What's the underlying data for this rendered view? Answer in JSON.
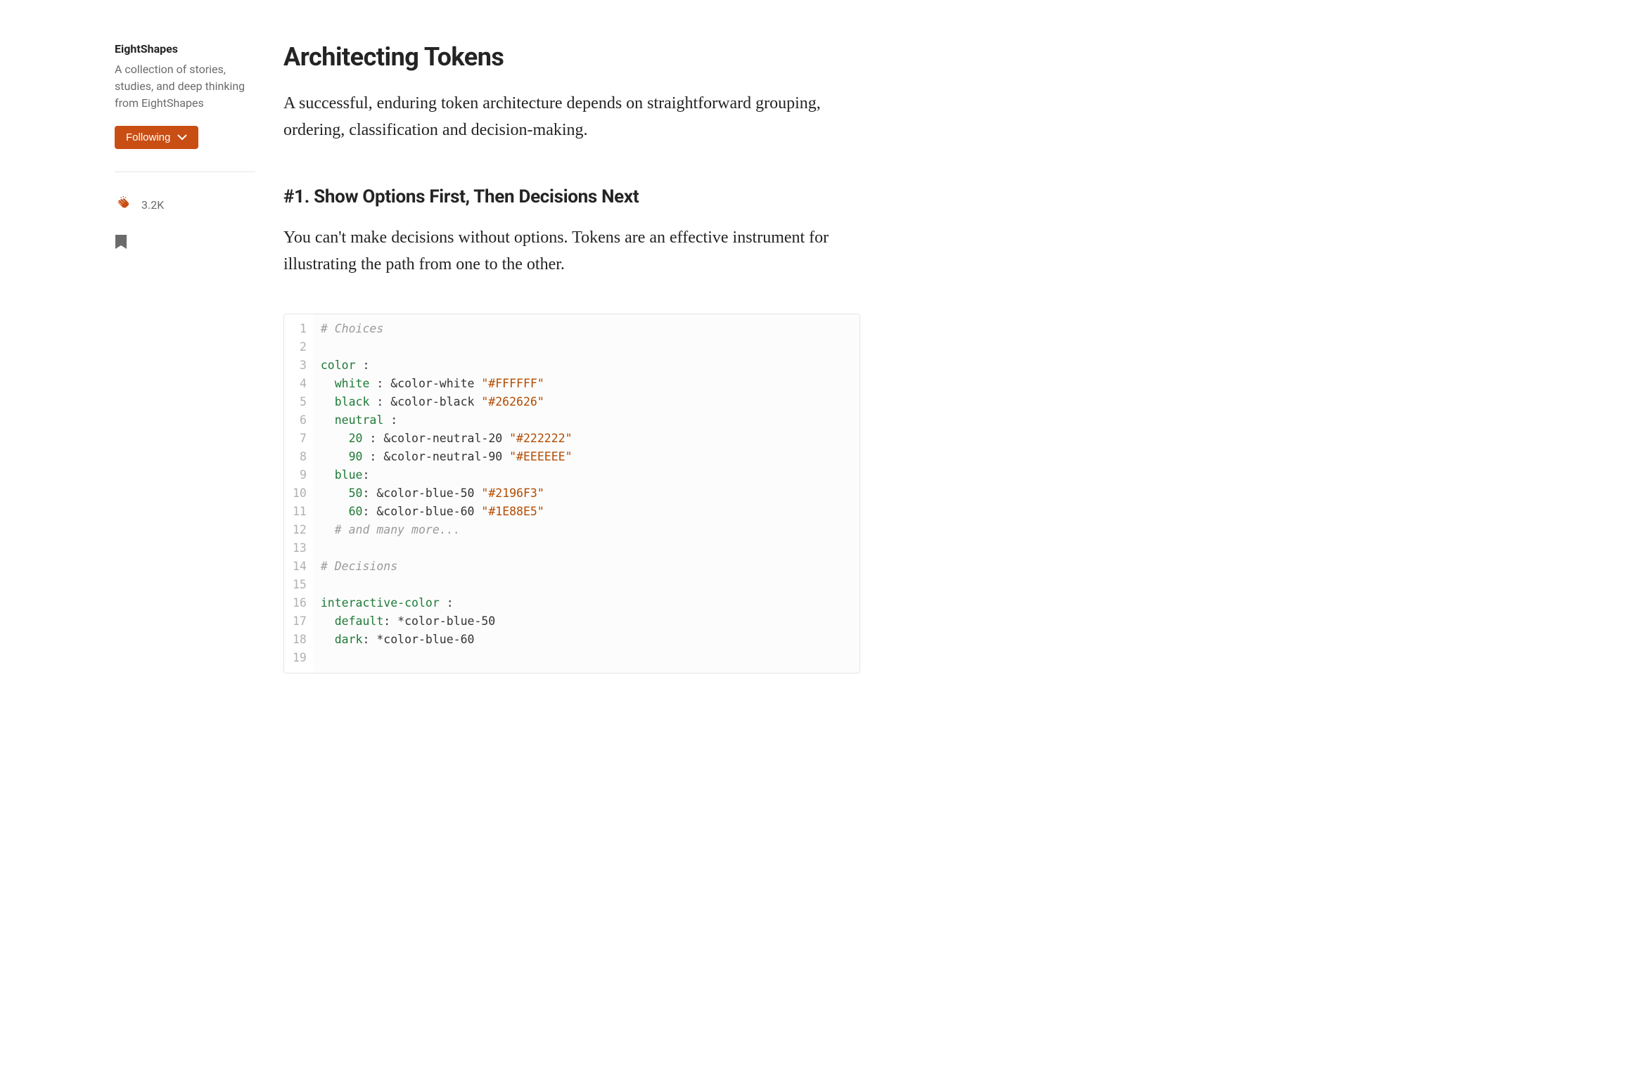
{
  "sidebar": {
    "publication_name": "EightShapes",
    "publication_description": "A collection of stories, studies, and deep thinking from EightShapes",
    "following_label": "Following",
    "clap_count": "3.2K"
  },
  "article": {
    "title": "Architecting Tokens",
    "lede": "A successful, enduring token architecture depends on straightforward grouping, ordering, classification and decision-making.",
    "section1_heading": "#1. Show Options First, Then Decisions Next",
    "section1_body": "You can't make decisions without options. Tokens are an effective instrument for illustrating the path from one to the other."
  },
  "code": {
    "lines": [
      {
        "n": 1,
        "segments": [
          {
            "cls": "c-comment",
            "text": "# Choices"
          }
        ]
      },
      {
        "n": 2,
        "segments": []
      },
      {
        "n": 3,
        "segments": [
          {
            "cls": "c-key",
            "text": "color"
          },
          {
            "cls": "c-punct",
            "text": " :"
          }
        ]
      },
      {
        "n": 4,
        "segments": [
          {
            "cls": "",
            "text": "  "
          },
          {
            "cls": "c-key",
            "text": "white"
          },
          {
            "cls": "c-punct",
            "text": " : "
          },
          {
            "cls": "c-anchor",
            "text": "&color-white "
          },
          {
            "cls": "c-string",
            "text": "\"#FFFFFF\""
          }
        ]
      },
      {
        "n": 5,
        "segments": [
          {
            "cls": "",
            "text": "  "
          },
          {
            "cls": "c-key",
            "text": "black"
          },
          {
            "cls": "c-punct",
            "text": " : "
          },
          {
            "cls": "c-anchor",
            "text": "&color-black "
          },
          {
            "cls": "c-string",
            "text": "\"#262626\""
          }
        ]
      },
      {
        "n": 6,
        "segments": [
          {
            "cls": "",
            "text": "  "
          },
          {
            "cls": "c-key",
            "text": "neutral"
          },
          {
            "cls": "c-punct",
            "text": " :"
          }
        ]
      },
      {
        "n": 7,
        "segments": [
          {
            "cls": "",
            "text": "    "
          },
          {
            "cls": "c-num",
            "text": "20"
          },
          {
            "cls": "c-punct",
            "text": " : "
          },
          {
            "cls": "c-anchor",
            "text": "&color-neutral-20 "
          },
          {
            "cls": "c-string",
            "text": "\"#222222\""
          }
        ]
      },
      {
        "n": 8,
        "segments": [
          {
            "cls": "",
            "text": "    "
          },
          {
            "cls": "c-num",
            "text": "90"
          },
          {
            "cls": "c-punct",
            "text": " : "
          },
          {
            "cls": "c-anchor",
            "text": "&color-neutral-90 "
          },
          {
            "cls": "c-string",
            "text": "\"#EEEEEE\""
          }
        ]
      },
      {
        "n": 9,
        "segments": [
          {
            "cls": "",
            "text": "  "
          },
          {
            "cls": "c-key",
            "text": "blue"
          },
          {
            "cls": "c-punct",
            "text": ":"
          }
        ]
      },
      {
        "n": 10,
        "segments": [
          {
            "cls": "",
            "text": "    "
          },
          {
            "cls": "c-num",
            "text": "50"
          },
          {
            "cls": "c-punct",
            "text": ": "
          },
          {
            "cls": "c-anchor",
            "text": "&color-blue-50 "
          },
          {
            "cls": "c-string",
            "text": "\"#2196F3\""
          }
        ]
      },
      {
        "n": 11,
        "segments": [
          {
            "cls": "",
            "text": "    "
          },
          {
            "cls": "c-num",
            "text": "60"
          },
          {
            "cls": "c-punct",
            "text": ": "
          },
          {
            "cls": "c-anchor",
            "text": "&color-blue-60 "
          },
          {
            "cls": "c-string",
            "text": "\"#1E88E5\""
          }
        ]
      },
      {
        "n": 12,
        "segments": [
          {
            "cls": "",
            "text": "  "
          },
          {
            "cls": "c-comment",
            "text": "# and many more..."
          }
        ]
      },
      {
        "n": 13,
        "segments": []
      },
      {
        "n": 14,
        "segments": [
          {
            "cls": "c-comment",
            "text": "# Decisions"
          }
        ]
      },
      {
        "n": 15,
        "segments": []
      },
      {
        "n": 16,
        "segments": [
          {
            "cls": "c-key",
            "text": "interactive-color"
          },
          {
            "cls": "c-punct",
            "text": " :"
          }
        ]
      },
      {
        "n": 17,
        "segments": [
          {
            "cls": "",
            "text": "  "
          },
          {
            "cls": "c-key",
            "text": "default"
          },
          {
            "cls": "c-punct",
            "text": ": "
          },
          {
            "cls": "c-ref",
            "text": "*color-blue-50"
          }
        ]
      },
      {
        "n": 18,
        "segments": [
          {
            "cls": "",
            "text": "  "
          },
          {
            "cls": "c-key",
            "text": "dark"
          },
          {
            "cls": "c-punct",
            "text": ": "
          },
          {
            "cls": "c-ref",
            "text": "*color-blue-60"
          }
        ]
      },
      {
        "n": 19,
        "segments": []
      }
    ]
  }
}
